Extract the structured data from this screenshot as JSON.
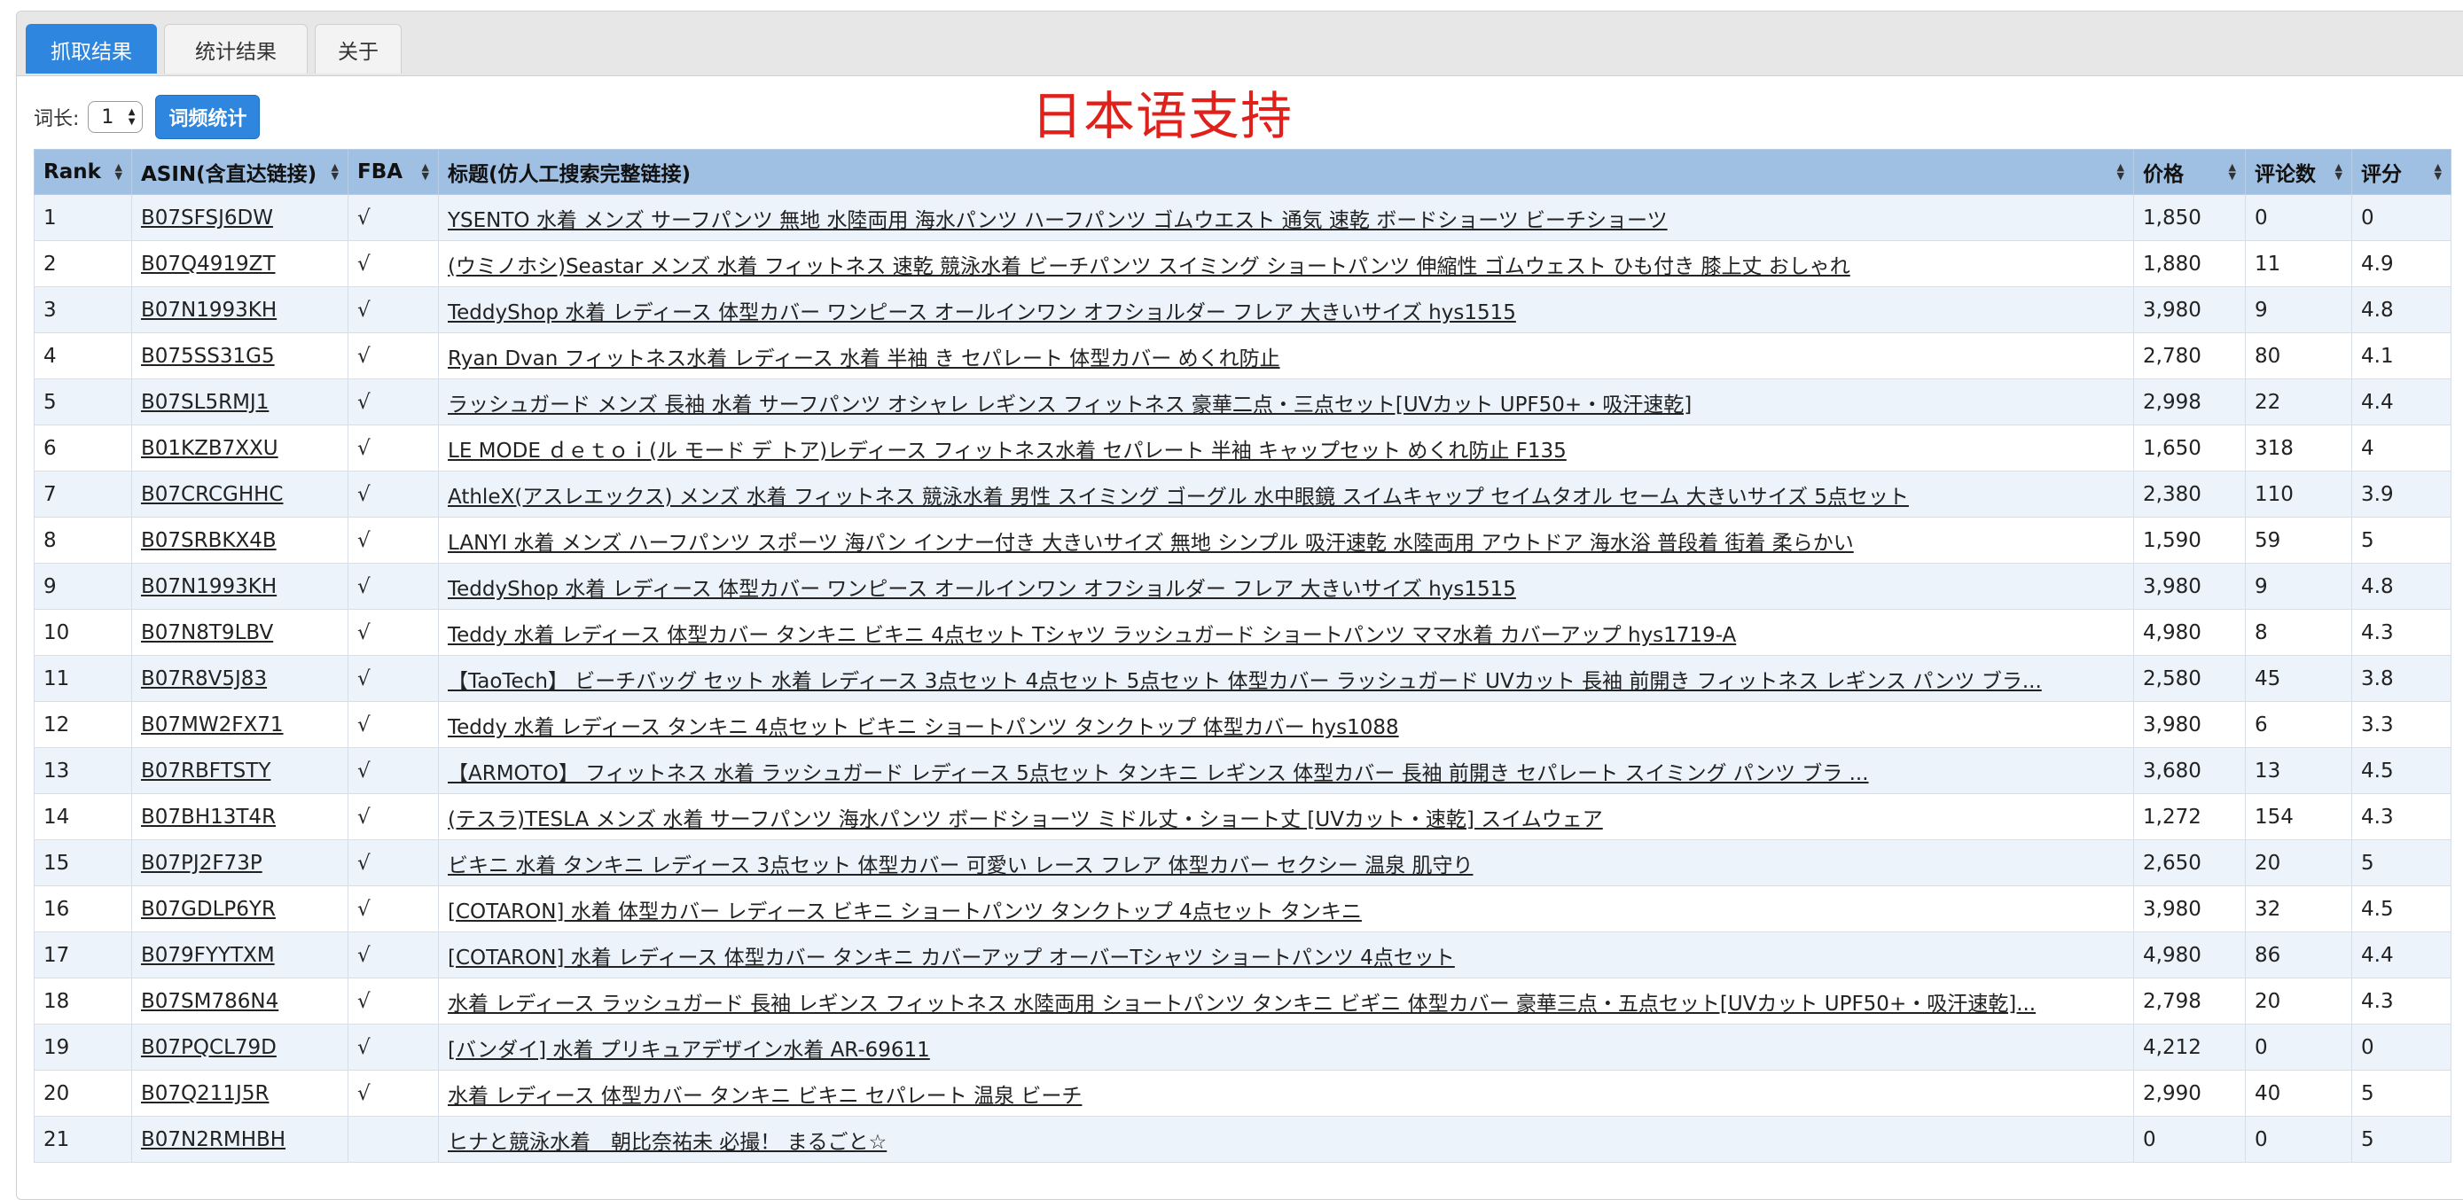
{
  "tabs": [
    {
      "label": "抓取结果",
      "active": true
    },
    {
      "label": "统计结果",
      "active": false
    },
    {
      "label": "关于",
      "active": false
    }
  ],
  "toolbar": {
    "word_length_label": "词长:",
    "word_length_value": "1",
    "freq_button": "词频统计"
  },
  "overlay_title": "日本语支持",
  "colors": {
    "accent": "#2f86de",
    "header_bg": "#9fbfe3",
    "overlay_text": "#e0201a"
  },
  "table": {
    "headers": [
      "Rank",
      "ASIN(含直达链接)",
      "FBA",
      "标题(仿人工搜索完整链接)",
      "价格",
      "评论数",
      "评分"
    ],
    "rows": [
      {
        "rank": "1",
        "asin": "B07SFSJ6DW",
        "fba": "√",
        "title": "YSENTO 水着 メンズ サーフパンツ 無地 水陸両用 海水パンツ ハーフパンツ ゴムウエスト 通気 速乾 ボードショーツ ビーチショーツ",
        "price": "1,850",
        "reviews": "0",
        "rating": "0"
      },
      {
        "rank": "2",
        "asin": "B07Q4919ZT",
        "fba": "√",
        "title": "(ウミノホシ)Seastar メンズ 水着 フィットネス 速乾 競泳水着 ビーチパンツ スイミング ショートパンツ 伸縮性 ゴムウェスト ひも付き 膝上丈 おしゃれ",
        "price": "1,880",
        "reviews": "11",
        "rating": "4.9"
      },
      {
        "rank": "3",
        "asin": "B07N1993KH",
        "fba": "√",
        "title": "TeddyShop 水着 レディース 体型カバー ワンピース オールインワン オフショルダー フレア 大きいサイズ hys1515",
        "price": "3,980",
        "reviews": "9",
        "rating": "4.8"
      },
      {
        "rank": "4",
        "asin": "B075SS31G5",
        "fba": "√",
        "title": "Ryan Dvan フィットネス水着 レディース 水着 半袖 き セパレート 体型カバー めくれ防止",
        "price": "2,780",
        "reviews": "80",
        "rating": "4.1"
      },
      {
        "rank": "5",
        "asin": "B07SL5RMJ1",
        "fba": "√",
        "title": "ラッシュガード メンズ 長袖 水着 サーフパンツ オシャレ レギンス フィットネス 豪華二点・三点セット[UVカット UPF50+・吸汗速乾]",
        "price": "2,998",
        "reviews": "22",
        "rating": "4.4"
      },
      {
        "rank": "6",
        "asin": "B01KZB7XXU",
        "fba": "√",
        "title": "LE MODE ｄｅｔｏｉ(ル モード デ トア)レディース フィットネス水着 セパレート 半袖 キャップセット めくれ防止 F135",
        "price": "1,650",
        "reviews": "318",
        "rating": "4"
      },
      {
        "rank": "7",
        "asin": "B07CRCGHHC",
        "fba": "√",
        "title": "AthleX(アスレエックス) メンズ 水着 フィットネス 競泳水着 男性 スイミング ゴーグル 水中眼鏡 スイムキャップ セイムタオル セーム 大きいサイズ 5点セット",
        "price": "2,380",
        "reviews": "110",
        "rating": "3.9"
      },
      {
        "rank": "8",
        "asin": "B07SRBKX4B",
        "fba": "√",
        "title": "LANYI 水着 メンズ ハーフパンツ スポーツ 海パン インナー付き 大きいサイズ 無地 シンプル 吸汗速乾 水陸両用 アウトドア 海水浴 普段着 街着 柔らかい",
        "price": "1,590",
        "reviews": "59",
        "rating": "5"
      },
      {
        "rank": "9",
        "asin": "B07N1993KH",
        "fba": "√",
        "title": "TeddyShop 水着 レディース 体型カバー ワンピース オールインワン オフショルダー フレア 大きいサイズ hys1515",
        "price": "3,980",
        "reviews": "9",
        "rating": "4.8"
      },
      {
        "rank": "10",
        "asin": "B07N8T9LBV",
        "fba": "√",
        "title": "Teddy 水着 レディース 体型カバー タンキニ ビキニ 4点セット Tシャツ ラッシュガード ショートパンツ ママ水着 カバーアップ hys1719-A",
        "price": "4,980",
        "reviews": "8",
        "rating": "4.3"
      },
      {
        "rank": "11",
        "asin": "B07R8V5J83",
        "fba": "√",
        "title": "【TaoTech】 ビーチバッグ セット 水着 レディース 3点セット 4点セット 5点セット 体型カバー ラッシュガード UVカット 長袖 前開き フィットネス レギンス パンツ ブラ...",
        "price": "2,580",
        "reviews": "45",
        "rating": "3.8"
      },
      {
        "rank": "12",
        "asin": "B07MW2FX71",
        "fba": "√",
        "title": "Teddy 水着 レディース タンキニ 4点セット ビキニ ショートパンツ タンクトップ 体型カバー hys1088",
        "price": "3,980",
        "reviews": "6",
        "rating": "3.3"
      },
      {
        "rank": "13",
        "asin": "B07RBFTSTY",
        "fba": "√",
        "title": "【ARMOTO】 フィットネス 水着 ラッシュガード レディース 5点セット タンキニ レギンス 体型カバー 長袖 前開き セパレート スイミング パンツ ブラ ...",
        "price": "3,680",
        "reviews": "13",
        "rating": "4.5"
      },
      {
        "rank": "14",
        "asin": "B07BH13T4R",
        "fba": "√",
        "title": "(テスラ)TESLA メンズ 水着 サーフパンツ 海水パンツ ボードショーツ ミドル丈・ショート丈 [UVカット・速乾] スイムウェア",
        "price": "1,272",
        "reviews": "154",
        "rating": "4.3"
      },
      {
        "rank": "15",
        "asin": "B07PJ2F73P",
        "fba": "√",
        "title": "ビキニ 水着 タンキニ レディース 3点セット 体型カバー 可愛い レース フレア 体型カバー セクシー 温泉 肌守り",
        "price": "2,650",
        "reviews": "20",
        "rating": "5"
      },
      {
        "rank": "16",
        "asin": "B07GDLP6YR",
        "fba": "√",
        "title": "[COTARON] 水着 体型カバー レディース ビキニ ショートパンツ タンクトップ 4点セット タンキニ",
        "price": "3,980",
        "reviews": "32",
        "rating": "4.5"
      },
      {
        "rank": "17",
        "asin": "B079FYYTXM",
        "fba": "√",
        "title": "[COTARON] 水着 レディース 体型カバー タンキニ カバーアップ オーバーTシャツ ショートパンツ 4点セット",
        "price": "4,980",
        "reviews": "86",
        "rating": "4.4"
      },
      {
        "rank": "18",
        "asin": "B07SM786N4",
        "fba": "√",
        "title": "水着 レディース ラッシュガード 長袖 レギンス フィットネス 水陸両用 ショートパンツ タンキニ ビギニ 体型カバー 豪華三点・五点セット[UVカット UPF50+・吸汗速乾]...",
        "price": "2,798",
        "reviews": "20",
        "rating": "4.3"
      },
      {
        "rank": "19",
        "asin": "B07PQCL79D",
        "fba": "√",
        "title": "[バンダイ] 水着 プリキュアデザイン水着 AR-69611",
        "price": "4,212",
        "reviews": "0",
        "rating": "0"
      },
      {
        "rank": "20",
        "asin": "B07Q211J5R",
        "fba": "√",
        "title": "水着 レディース 体型カバー タンキニ ビキニ セパレート 温泉 ビーチ",
        "price": "2,990",
        "reviews": "40",
        "rating": "5"
      },
      {
        "rank": "21",
        "asin": "B07N2RMHBH",
        "fba": "",
        "title": "ヒナと競泳水着　朝比奈祐未 必撮！ まるごと☆",
        "price": "0",
        "reviews": "0",
        "rating": "5"
      }
    ]
  }
}
